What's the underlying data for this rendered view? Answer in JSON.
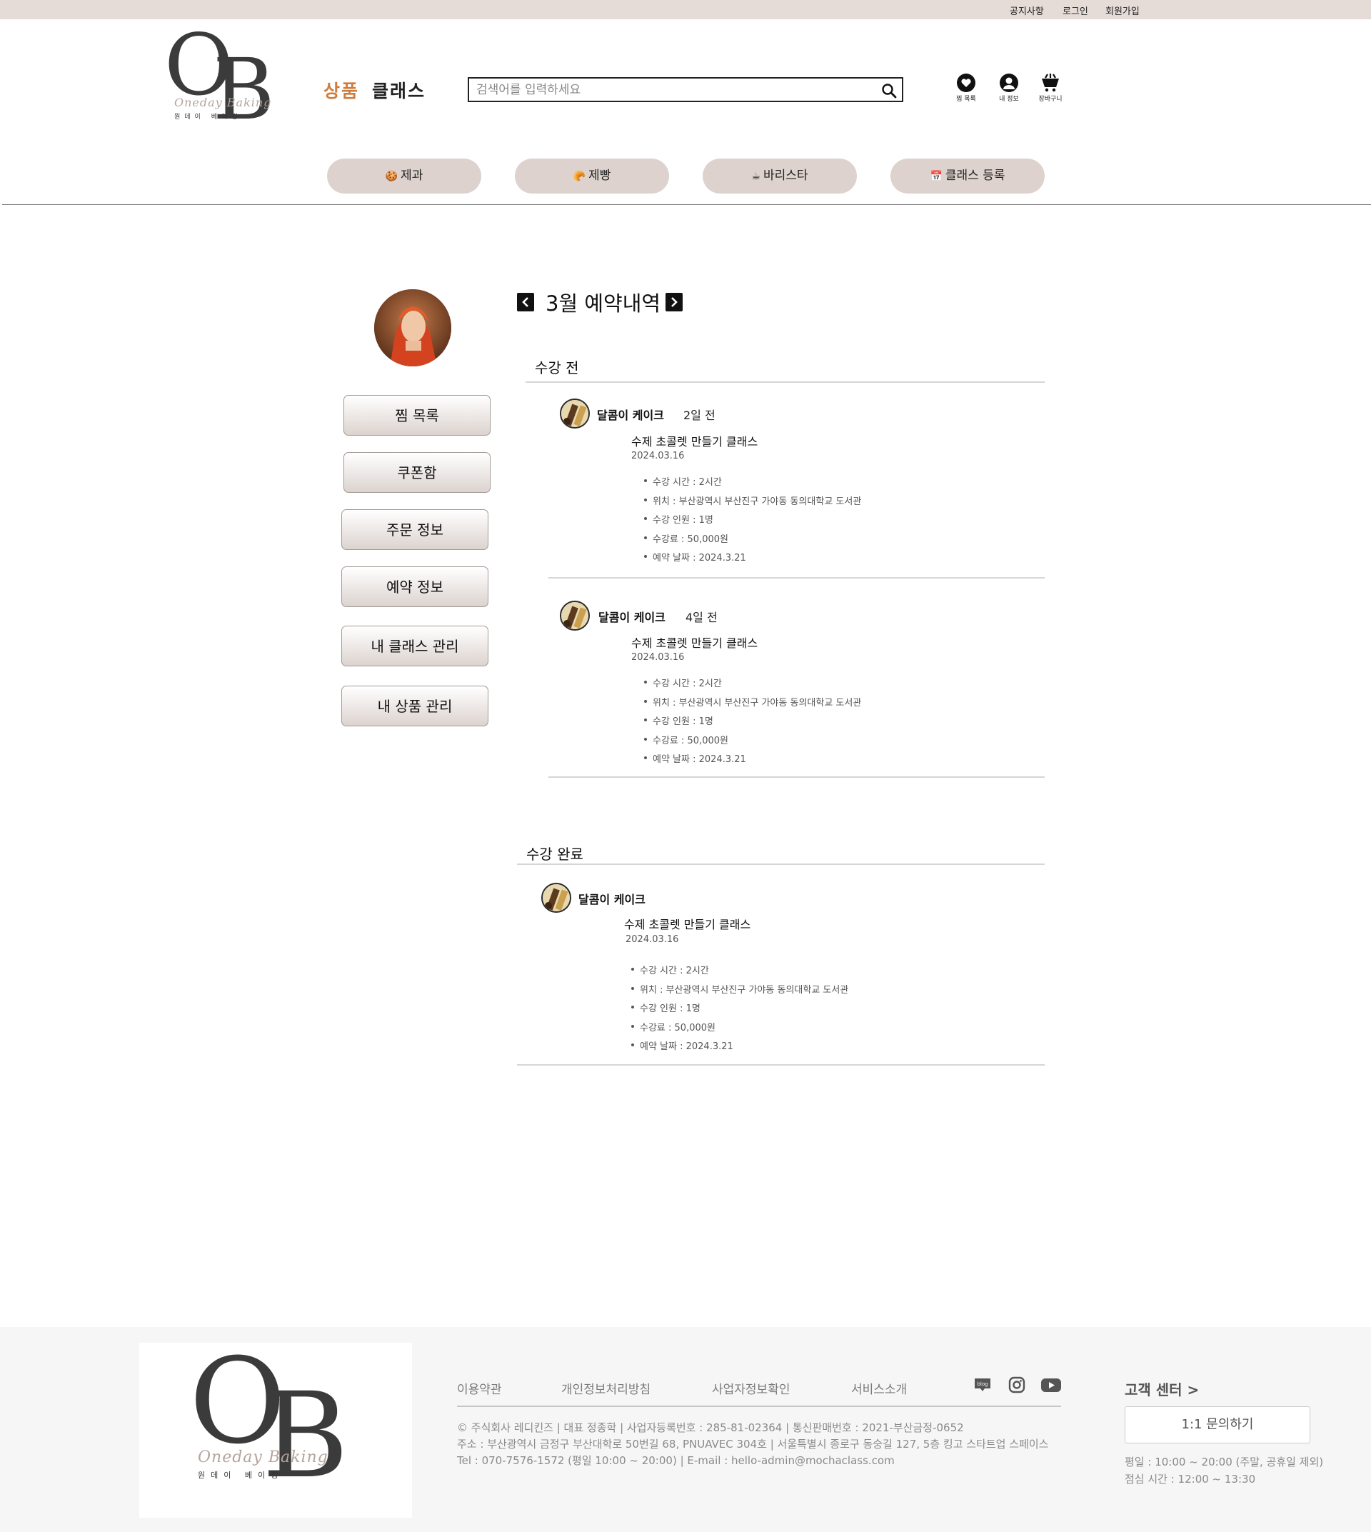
{
  "topbar": {
    "notice": "공지사항",
    "login": "로그인",
    "signup": "회원가입"
  },
  "logo": {
    "letter1": "O",
    "letter2": "B",
    "script": "Oneday Baking",
    "korean": "원데이 베이킹"
  },
  "nav": {
    "products": "상품",
    "classes": "클래스"
  },
  "search": {
    "placeholder": "검색어를 입력하세요",
    "value": ""
  },
  "header_icons": {
    "wishlist": "찜 목록",
    "my_info": "내 정보",
    "cart": "장바구니"
  },
  "categories": [
    {
      "emoji": "🍪",
      "label": "제과"
    },
    {
      "emoji": "🥐",
      "label": "제빵"
    },
    {
      "emoji": "☕",
      "label": "바리스타"
    },
    {
      "emoji": "📅",
      "label": "클래스 등록"
    }
  ],
  "sidebar": {
    "items": [
      {
        "label": "찜 목록"
      },
      {
        "label": "쿠폰함"
      },
      {
        "label": "주문 정보"
      },
      {
        "label": "예약 정보"
      },
      {
        "label": "내 클래스 관리"
      },
      {
        "label": "내 상품 관리"
      }
    ]
  },
  "main": {
    "month_title": "3월 예약내역",
    "upcoming": {
      "title": "수강 전",
      "items": [
        {
          "name": "달콤이 케이크",
          "ago": "2일 전",
          "class_title": "수제 초콜렛 만들기 클래스",
          "date": "2024.03.16",
          "details": [
            "수강 시간 : 2시간",
            "위치 : 부산광역시 부산진구 가야동 동의대학교 도서관",
            "수강 인원 : 1명",
            "수강료 : 50,000원",
            "예약 날짜 : 2024.3.21"
          ]
        },
        {
          "name": "달콤이 케이크",
          "ago": "4일 전",
          "class_title": "수제 초콜렛 만들기 클래스",
          "date": "2024.03.16",
          "details": [
            "수강 시간 : 2시간",
            "위치 : 부산광역시 부산진구 가야동 동의대학교 도서관",
            "수강 인원 : 1명",
            "수강료 : 50,000원",
            "예약 날짜 : 2024.3.21"
          ]
        }
      ]
    },
    "completed": {
      "title": "수강 완료",
      "items": [
        {
          "name": "달콤이 케이크",
          "class_title": "수제 초콜렛 만들기 클래스",
          "date": "2024.03.16",
          "details": [
            "수강 시간 : 2시간",
            "위치 : 부산광역시 부산진구 가야동 동의대학교 도서관",
            "수강 인원 : 1명",
            "수강료 : 50,000원",
            "예약 날짜 : 2024.3.21"
          ]
        }
      ]
    }
  },
  "footer": {
    "links": [
      "이용약관",
      "개인정보처리방침",
      "사업자정보확인",
      "서비스소개"
    ],
    "social": [
      "blog-icon",
      "instagram-icon",
      "youtube-icon"
    ],
    "blog_text": "blog",
    "info_lines": [
      "© 주식회사 레디킨즈 | 대표 정종학 | 사업자등록번호 : 285-81-02364 | 통신판매번호 : 2021-부산금정-0652",
      "주소 : 부산광역시 금정구 부산대학로 50번길 68, PNUAVEC 304호 | 서울특별시 종로구 동숭길 127, 5층 킹고 스타트업 스페이스",
      "Tel : 070-7576-1572 (평일 10:00 ~ 20:00) | E-mail : hello-admin@mochaclass.com"
    ],
    "cs_title": "고객 센터 >",
    "cs_button": "1:1 문의하기",
    "hours": [
      "평일 : 10:00 ~ 20:00 (주말, 공휴일 제외)",
      "점심 시간 : 12:00 ~ 13:30"
    ]
  },
  "colors": {
    "accent": "#cf7d3e",
    "topbar": "#e5dcd8",
    "category_bg": "#ddd2ce",
    "footer_bg": "#f6f6f6"
  }
}
